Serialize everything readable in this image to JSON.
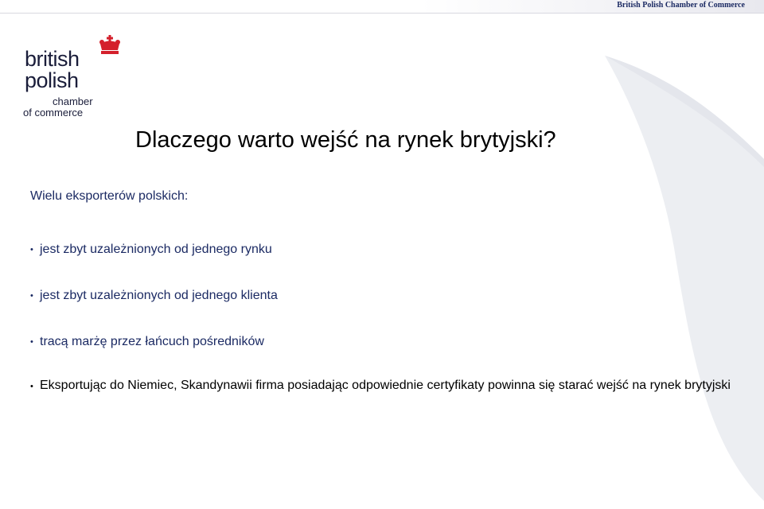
{
  "header": {
    "title": "British Polish Chamber of Commerce"
  },
  "logo": {
    "line1": "british",
    "line2": "polish",
    "line3": "chamber",
    "line4": "of commerce",
    "crown_icon": "crown-icon",
    "crown_color": "#d4202c"
  },
  "slide": {
    "title": "Dlaczego warto wejść na rynek brytyjski?",
    "intro": "Wielu eksporterów polskich:",
    "bullets": [
      "jest zbyt uzależnionych od jednego rynku",
      "jest zbyt uzależnionych od jednego klienta",
      "tracą marżę przez łańcuch pośredników"
    ],
    "final_bullet": "Eksportując do Niemiec, Skandynawii firma posiadając odpowiednie certyfikaty powinna się starać wejść na rynek brytyjski"
  },
  "colors": {
    "header_text": "#1b2a63",
    "body_text": "#1b2a63",
    "logo_text": "#1a1d3a",
    "background_shape": "#eceef2"
  }
}
